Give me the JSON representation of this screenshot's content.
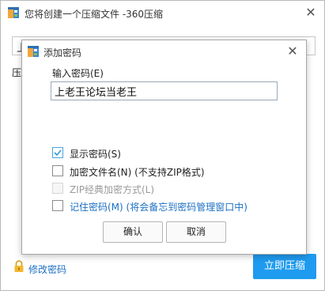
{
  "outer_window": {
    "title": "您将创建一个压缩文件 -360压缩",
    "close_glyph": "✕",
    "filename_fragment": "上",
    "label_fragment": "压",
    "edit_password_label": "修改密码",
    "compress_button_label": "立即压缩"
  },
  "dialog": {
    "title": "添加密码",
    "close_glyph": "✕",
    "password_label": "输入密码(E)",
    "password_value": "上老王论坛当老王",
    "options": {
      "show_password": {
        "label": "显示密码(S)",
        "checked": true
      },
      "encrypt_filenames": {
        "label": "加密文件名(N)",
        "note": "(不支持ZIP格式)",
        "checked": false
      },
      "zip_classic": {
        "label": "ZIP经典加密方式(L)",
        "checked": false,
        "disabled": true
      },
      "remember_password": {
        "label": "记住密码(M)",
        "note": "(将会备忘到密码管理窗口中)",
        "checked": false
      }
    },
    "ok_label": "确认",
    "cancel_label": "取消"
  },
  "colors": {
    "accent": "#1e9bef",
    "link_blue": "#1a6fc4",
    "check_blue": "#2f9ae0",
    "disabled_text": "#9a9a9a"
  },
  "icons": {
    "app_icon": "zip-archive-icon",
    "lock_icon": "lock-icon",
    "check_icon": "check-icon",
    "close_icon": "close-icon"
  }
}
